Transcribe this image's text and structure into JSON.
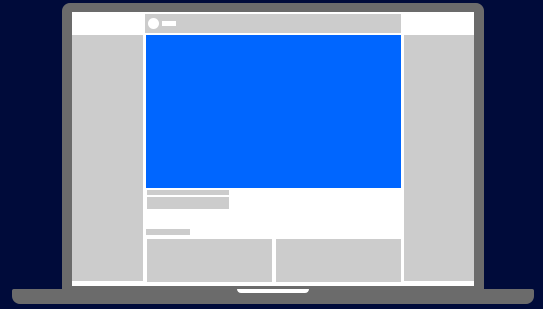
{
  "colors": {
    "background": "#000b3a",
    "laptop_body": "#6b6b6b",
    "screen": "#ffffff",
    "placeholder": "#cccccc",
    "hero": "#0066ff",
    "trackpad_notch": "#ffffff"
  },
  "icons": {
    "avatar": "user-avatar-circle"
  }
}
